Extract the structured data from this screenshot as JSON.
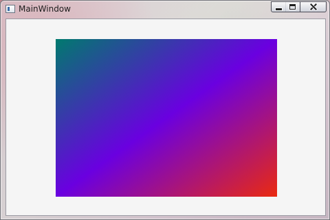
{
  "window": {
    "title": "MainWindow",
    "app_icon": "window-app-icon",
    "controls": {
      "minimize_icon": "minimize-icon",
      "maximize_icon": "maximize-icon",
      "close_icon": "close-icon"
    }
  },
  "canvas": {
    "gradient": {
      "stops": [
        {
          "offset": 0.0,
          "color": "#007a6e"
        },
        {
          "offset": 0.5,
          "color": "#6a00e0"
        },
        {
          "offset": 1.0,
          "color": "#ea2a10"
        }
      ]
    }
  }
}
